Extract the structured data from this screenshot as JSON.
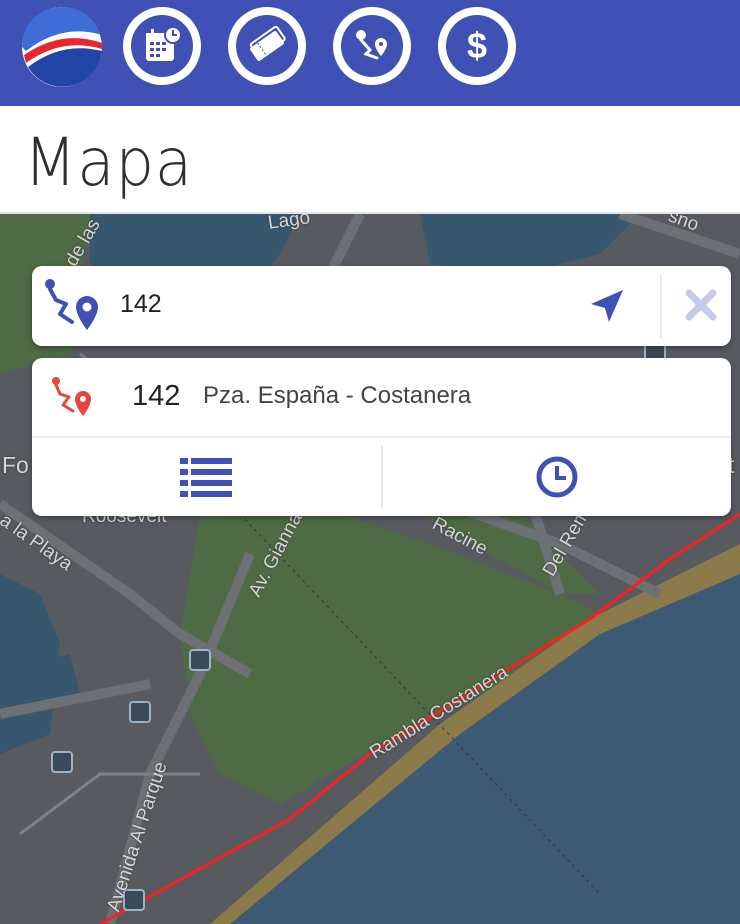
{
  "header": {
    "nav": [
      {
        "name": "logo",
        "icon": "brand-logo-icon"
      },
      {
        "name": "schedule",
        "icon": "calendar-clock-icon"
      },
      {
        "name": "tickets",
        "icon": "ticket-icon"
      },
      {
        "name": "routes",
        "icon": "route-icon"
      },
      {
        "name": "fares",
        "icon": "dollar-icon"
      }
    ],
    "color": "#3f51b5"
  },
  "page": {
    "title": "Mapa"
  },
  "search": {
    "value": "142",
    "route_icon": "route-pin-icon",
    "locate_icon": "navigation-arrow-icon",
    "clear_icon": "close-icon"
  },
  "result": {
    "line": "142",
    "description": "Pza. España - Costanera",
    "route_icon": "route-pin-red-icon",
    "list_icon": "list-icon",
    "schedule_icon": "clock-icon"
  },
  "map": {
    "labels": {
      "lago": "Lago",
      "las": "de las",
      "roosevelt": "Roosevelt",
      "playa": "a la Playa",
      "gianna": "Av. Gianna",
      "racine": "Racine",
      "delrem": "Del Rem",
      "rambla": "Rambla Costanera",
      "parque": "Avenida Al Parque",
      "fo": "Fo",
      "t": "t",
      "sno": "sno"
    },
    "route_color": "#ff1e1e",
    "water_color": "#37576e",
    "park_color": "#4e6b45"
  }
}
